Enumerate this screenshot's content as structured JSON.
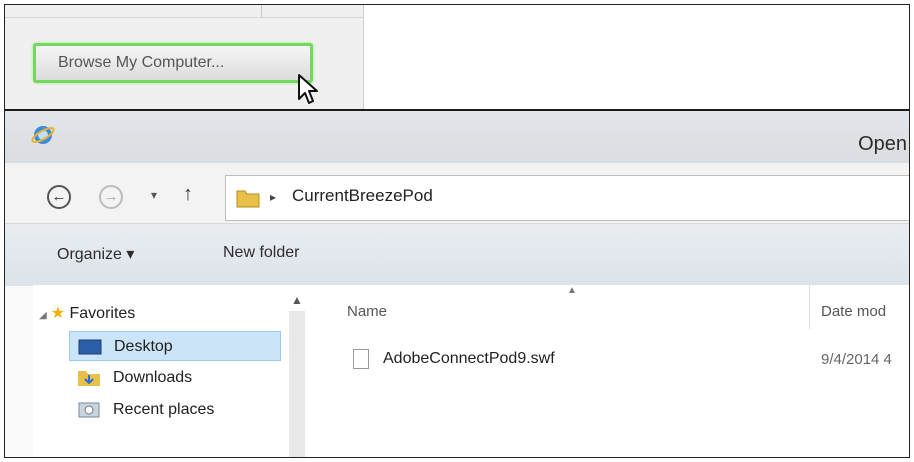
{
  "browse": {
    "label": "Browse My Computer..."
  },
  "dialog": {
    "title": "Open",
    "address": {
      "path": "CurrentBreezePod"
    },
    "toolbar": {
      "organize": "Organize ▾",
      "new_folder": "New folder"
    },
    "nav": {
      "favorites": "Favorites",
      "items": [
        {
          "label": "Desktop",
          "selected": true
        },
        {
          "label": "Downloads"
        },
        {
          "label": "Recent places"
        }
      ]
    },
    "columns": {
      "name": "Name",
      "date": "Date mod"
    },
    "files": [
      {
        "name": "AdobeConnectPod9.swf",
        "date": "9/4/2014 4"
      }
    ]
  },
  "colors": {
    "highlight_green": "#74d85c",
    "selection_blue": "#cce4f7"
  }
}
